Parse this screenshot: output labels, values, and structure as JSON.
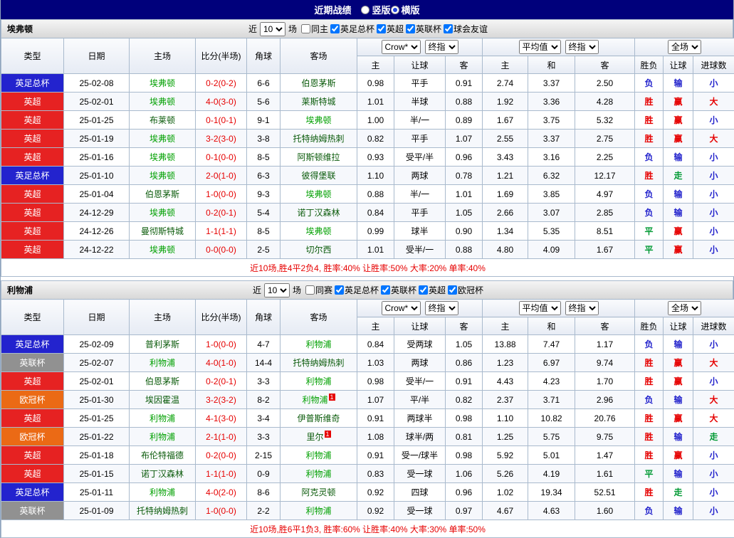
{
  "title_bar": {
    "title": "近期战绩",
    "options": [
      {
        "label": "竖版",
        "selected": false
      },
      {
        "label": "横版",
        "selected": true
      }
    ]
  },
  "filter_labels": {
    "recent": "近",
    "matches": "场"
  },
  "columns": {
    "main": [
      "类型",
      "日期",
      "主场",
      "比分(半场)",
      "角球",
      "客场"
    ],
    "odds_selects_1": [
      "Crow*",
      "终指"
    ],
    "odds_cols_1": [
      "主",
      "让球",
      "客"
    ],
    "odds_selects_2": [
      "平均值",
      "终指"
    ],
    "odds_cols_2": [
      "主",
      "和",
      "客"
    ],
    "result_select": "全场",
    "result_cols": [
      "胜负",
      "让球",
      "进球数"
    ]
  },
  "colors": {
    "titlebar_bg": "#00007B",
    "score": "#E60000",
    "summary": "#E60000",
    "focus_team": "#00A000",
    "opponent_team": "#0B5B0B",
    "leagues": {
      "fa": "#2323CE",
      "pl": "#E62222",
      "efl": "#919191",
      "ucl": "#EB6A15"
    },
    "results": {
      "red": "#E60000",
      "blue": "#2222CC",
      "green": "#009933"
    }
  },
  "sections": [
    {
      "team": "埃弗顿",
      "recent_value": "10",
      "same_checkbox": {
        "label": "同主",
        "checked": false
      },
      "leagues": [
        {
          "label": "英足总杯",
          "checked": true
        },
        {
          "label": "英超",
          "checked": true
        },
        {
          "label": "英联杯",
          "checked": true
        },
        {
          "label": "球会友谊",
          "checked": true
        }
      ],
      "rows": [
        {
          "league": "英足总杯",
          "league_key": "fa",
          "date": "25-02-08",
          "home": {
            "name": "埃弗顿",
            "focus": true
          },
          "score": "0-2(0-2)",
          "corners": "6-6",
          "away": {
            "name": "伯恩茅斯",
            "focus": false
          },
          "odds": [
            "0.98",
            "平手",
            "0.91"
          ],
          "avg": [
            "2.74",
            "3.37",
            "2.50"
          ],
          "results": [
            {
              "text": "负",
              "color": "blue"
            },
            {
              "text": "输",
              "color": "blue"
            },
            {
              "text": "小",
              "color": "blue"
            }
          ]
        },
        {
          "league": "英超",
          "league_key": "pl",
          "date": "25-02-01",
          "home": {
            "name": "埃弗顿",
            "focus": true
          },
          "score": "4-0(3-0)",
          "corners": "5-6",
          "away": {
            "name": "莱斯特城",
            "focus": false
          },
          "odds": [
            "1.01",
            "半球",
            "0.88"
          ],
          "avg": [
            "1.92",
            "3.36",
            "4.28"
          ],
          "results": [
            {
              "text": "胜",
              "color": "red"
            },
            {
              "text": "赢",
              "color": "red"
            },
            {
              "text": "大",
              "color": "red"
            }
          ]
        },
        {
          "league": "英超",
          "league_key": "pl",
          "date": "25-01-25",
          "home": {
            "name": "布莱顿",
            "focus": false
          },
          "score": "0-1(0-1)",
          "corners": "9-1",
          "away": {
            "name": "埃弗顿",
            "focus": true
          },
          "odds": [
            "1.00",
            "半/一",
            "0.89"
          ],
          "avg": [
            "1.67",
            "3.75",
            "5.32"
          ],
          "results": [
            {
              "text": "胜",
              "color": "red"
            },
            {
              "text": "赢",
              "color": "red"
            },
            {
              "text": "小",
              "color": "blue"
            }
          ]
        },
        {
          "league": "英超",
          "league_key": "pl",
          "date": "25-01-19",
          "home": {
            "name": "埃弗顿",
            "focus": true
          },
          "score": "3-2(3-0)",
          "corners": "3-8",
          "away": {
            "name": "托特纳姆热刺",
            "focus": false
          },
          "odds": [
            "0.82",
            "平手",
            "1.07"
          ],
          "avg": [
            "2.55",
            "3.37",
            "2.75"
          ],
          "results": [
            {
              "text": "胜",
              "color": "red"
            },
            {
              "text": "赢",
              "color": "red"
            },
            {
              "text": "大",
              "color": "red"
            }
          ]
        },
        {
          "league": "英超",
          "league_key": "pl",
          "date": "25-01-16",
          "home": {
            "name": "埃弗顿",
            "focus": true
          },
          "score": "0-1(0-0)",
          "corners": "8-5",
          "away": {
            "name": "阿斯顿维拉",
            "focus": false
          },
          "odds": [
            "0.93",
            "受平/半",
            "0.96"
          ],
          "avg": [
            "3.43",
            "3.16",
            "2.25"
          ],
          "results": [
            {
              "text": "负",
              "color": "blue"
            },
            {
              "text": "输",
              "color": "blue"
            },
            {
              "text": "小",
              "color": "blue"
            }
          ]
        },
        {
          "league": "英足总杯",
          "league_key": "fa",
          "date": "25-01-10",
          "home": {
            "name": "埃弗顿",
            "focus": true
          },
          "score": "2-0(1-0)",
          "corners": "6-3",
          "away": {
            "name": "彼得堡联",
            "focus": false
          },
          "odds": [
            "1.10",
            "两球",
            "0.78"
          ],
          "avg": [
            "1.21",
            "6.32",
            "12.17"
          ],
          "results": [
            {
              "text": "胜",
              "color": "red"
            },
            {
              "text": "走",
              "color": "green"
            },
            {
              "text": "小",
              "color": "blue"
            }
          ]
        },
        {
          "league": "英超",
          "league_key": "pl",
          "date": "25-01-04",
          "home": {
            "name": "伯恩茅斯",
            "focus": false
          },
          "score": "1-0(0-0)",
          "corners": "9-3",
          "away": {
            "name": "埃弗顿",
            "focus": true
          },
          "odds": [
            "0.88",
            "半/一",
            "1.01"
          ],
          "avg": [
            "1.69",
            "3.85",
            "4.97"
          ],
          "results": [
            {
              "text": "负",
              "color": "blue"
            },
            {
              "text": "输",
              "color": "blue"
            },
            {
              "text": "小",
              "color": "blue"
            }
          ]
        },
        {
          "league": "英超",
          "league_key": "pl",
          "date": "24-12-29",
          "home": {
            "name": "埃弗顿",
            "focus": true
          },
          "score": "0-2(0-1)",
          "corners": "5-4",
          "away": {
            "name": "诺丁汉森林",
            "focus": false
          },
          "odds": [
            "0.84",
            "平手",
            "1.05"
          ],
          "avg": [
            "2.66",
            "3.07",
            "2.85"
          ],
          "results": [
            {
              "text": "负",
              "color": "blue"
            },
            {
              "text": "输",
              "color": "blue"
            },
            {
              "text": "小",
              "color": "blue"
            }
          ]
        },
        {
          "league": "英超",
          "league_key": "pl",
          "date": "24-12-26",
          "home": {
            "name": "曼彻斯特城",
            "focus": false
          },
          "score": "1-1(1-1)",
          "corners": "8-5",
          "away": {
            "name": "埃弗顿",
            "focus": true
          },
          "odds": [
            "0.99",
            "球半",
            "0.90"
          ],
          "avg": [
            "1.34",
            "5.35",
            "8.51"
          ],
          "results": [
            {
              "text": "平",
              "color": "green"
            },
            {
              "text": "赢",
              "color": "red"
            },
            {
              "text": "小",
              "color": "blue"
            }
          ]
        },
        {
          "league": "英超",
          "league_key": "pl",
          "date": "24-12-22",
          "home": {
            "name": "埃弗顿",
            "focus": true
          },
          "score": "0-0(0-0)",
          "corners": "2-5",
          "away": {
            "name": "切尔西",
            "focus": false
          },
          "odds": [
            "1.01",
            "受半/一",
            "0.88"
          ],
          "avg": [
            "4.80",
            "4.09",
            "1.67"
          ],
          "results": [
            {
              "text": "平",
              "color": "green"
            },
            {
              "text": "赢",
              "color": "red"
            },
            {
              "text": "小",
              "color": "blue"
            }
          ]
        }
      ],
      "summary": "近10场,胜4平2负4, 胜率:40% 让胜率:50% 大率:20% 单率:40%"
    },
    {
      "team": "利物浦",
      "recent_value": "10",
      "same_checkbox": {
        "label": "同赛",
        "checked": false
      },
      "leagues": [
        {
          "label": "英足总杯",
          "checked": true
        },
        {
          "label": "英联杯",
          "checked": true
        },
        {
          "label": "英超",
          "checked": true
        },
        {
          "label": "欧冠杯",
          "checked": true
        }
      ],
      "rows": [
        {
          "league": "英足总杯",
          "league_key": "fa",
          "date": "25-02-09",
          "home": {
            "name": "普利茅斯",
            "focus": false
          },
          "score": "1-0(0-0)",
          "corners": "4-7",
          "away": {
            "name": "利物浦",
            "focus": true
          },
          "odds": [
            "0.84",
            "受两球",
            "1.05"
          ],
          "avg": [
            "13.88",
            "7.47",
            "1.17"
          ],
          "results": [
            {
              "text": "负",
              "color": "blue"
            },
            {
              "text": "输",
              "color": "blue"
            },
            {
              "text": "小",
              "color": "blue"
            }
          ]
        },
        {
          "league": "英联杯",
          "league_key": "efl",
          "date": "25-02-07",
          "home": {
            "name": "利物浦",
            "focus": true
          },
          "score": "4-0(1-0)",
          "corners": "14-4",
          "away": {
            "name": "托特纳姆热刺",
            "focus": false
          },
          "odds": [
            "1.03",
            "两球",
            "0.86"
          ],
          "avg": [
            "1.23",
            "6.97",
            "9.74"
          ],
          "results": [
            {
              "text": "胜",
              "color": "red"
            },
            {
              "text": "赢",
              "color": "red"
            },
            {
              "text": "大",
              "color": "red"
            }
          ]
        },
        {
          "league": "英超",
          "league_key": "pl",
          "date": "25-02-01",
          "home": {
            "name": "伯恩茅斯",
            "focus": false
          },
          "score": "0-2(0-1)",
          "corners": "3-3",
          "away": {
            "name": "利物浦",
            "focus": true
          },
          "odds": [
            "0.98",
            "受半/一",
            "0.91"
          ],
          "avg": [
            "4.43",
            "4.23",
            "1.70"
          ],
          "results": [
            {
              "text": "胜",
              "color": "red"
            },
            {
              "text": "赢",
              "color": "red"
            },
            {
              "text": "小",
              "color": "blue"
            }
          ]
        },
        {
          "league": "欧冠杯",
          "league_key": "ucl",
          "date": "25-01-30",
          "home": {
            "name": "埃因霍温",
            "focus": false
          },
          "score": "3-2(3-2)",
          "corners": "8-2",
          "away": {
            "name": "利物浦",
            "focus": true,
            "red_card": "1"
          },
          "odds": [
            "1.07",
            "平/半",
            "0.82"
          ],
          "avg": [
            "2.37",
            "3.71",
            "2.96"
          ],
          "results": [
            {
              "text": "负",
              "color": "blue"
            },
            {
              "text": "输",
              "color": "blue"
            },
            {
              "text": "大",
              "color": "red"
            }
          ]
        },
        {
          "league": "英超",
          "league_key": "pl",
          "date": "25-01-25",
          "home": {
            "name": "利物浦",
            "focus": true
          },
          "score": "4-1(3-0)",
          "corners": "3-4",
          "away": {
            "name": "伊普斯维奇",
            "focus": false
          },
          "odds": [
            "0.91",
            "两球半",
            "0.98"
          ],
          "avg": [
            "1.10",
            "10.82",
            "20.76"
          ],
          "results": [
            {
              "text": "胜",
              "color": "red"
            },
            {
              "text": "赢",
              "color": "red"
            },
            {
              "text": "大",
              "color": "red"
            }
          ]
        },
        {
          "league": "欧冠杯",
          "league_key": "ucl",
          "date": "25-01-22",
          "home": {
            "name": "利物浦",
            "focus": true
          },
          "score": "2-1(1-0)",
          "corners": "3-3",
          "away": {
            "name": "里尔",
            "focus": false,
            "red_card": "1"
          },
          "odds": [
            "1.08",
            "球半/两",
            "0.81"
          ],
          "avg": [
            "1.25",
            "5.75",
            "9.75"
          ],
          "results": [
            {
              "text": "胜",
              "color": "red"
            },
            {
              "text": "输",
              "color": "blue"
            },
            {
              "text": "走",
              "color": "green"
            }
          ]
        },
        {
          "league": "英超",
          "league_key": "pl",
          "date": "25-01-18",
          "home": {
            "name": "布伦特福德",
            "focus": false
          },
          "score": "0-2(0-0)",
          "corners": "2-15",
          "away": {
            "name": "利物浦",
            "focus": true
          },
          "odds": [
            "0.91",
            "受一/球半",
            "0.98"
          ],
          "avg": [
            "5.92",
            "5.01",
            "1.47"
          ],
          "results": [
            {
              "text": "胜",
              "color": "red"
            },
            {
              "text": "赢",
              "color": "red"
            },
            {
              "text": "小",
              "color": "blue"
            }
          ]
        },
        {
          "league": "英超",
          "league_key": "pl",
          "date": "25-01-15",
          "home": {
            "name": "诺丁汉森林",
            "focus": false
          },
          "score": "1-1(1-0)",
          "corners": "0-9",
          "away": {
            "name": "利物浦",
            "focus": true
          },
          "odds": [
            "0.83",
            "受一球",
            "1.06"
          ],
          "avg": [
            "5.26",
            "4.19",
            "1.61"
          ],
          "results": [
            {
              "text": "平",
              "color": "green"
            },
            {
              "text": "输",
              "color": "blue"
            },
            {
              "text": "小",
              "color": "blue"
            }
          ]
        },
        {
          "league": "英足总杯",
          "league_key": "fa",
          "date": "25-01-11",
          "home": {
            "name": "利物浦",
            "focus": true
          },
          "score": "4-0(2-0)",
          "corners": "8-6",
          "away": {
            "name": "阿克灵顿",
            "focus": false
          },
          "odds": [
            "0.92",
            "四球",
            "0.96"
          ],
          "avg": [
            "1.02",
            "19.34",
            "52.51"
          ],
          "results": [
            {
              "text": "胜",
              "color": "red"
            },
            {
              "text": "走",
              "color": "green"
            },
            {
              "text": "小",
              "color": "blue"
            }
          ]
        },
        {
          "league": "英联杯",
          "league_key": "efl",
          "date": "25-01-09",
          "home": {
            "name": "托特纳姆热刺",
            "focus": false
          },
          "score": "1-0(0-0)",
          "corners": "2-2",
          "away": {
            "name": "利物浦",
            "focus": true
          },
          "odds": [
            "0.92",
            "受一球",
            "0.97"
          ],
          "avg": [
            "4.67",
            "4.63",
            "1.60"
          ],
          "results": [
            {
              "text": "负",
              "color": "blue"
            },
            {
              "text": "输",
              "color": "blue"
            },
            {
              "text": "小",
              "color": "blue"
            }
          ]
        }
      ],
      "summary": "近10场,胜6平1负3, 胜率:60% 让胜率:40% 大率:30% 单率:50%"
    }
  ]
}
